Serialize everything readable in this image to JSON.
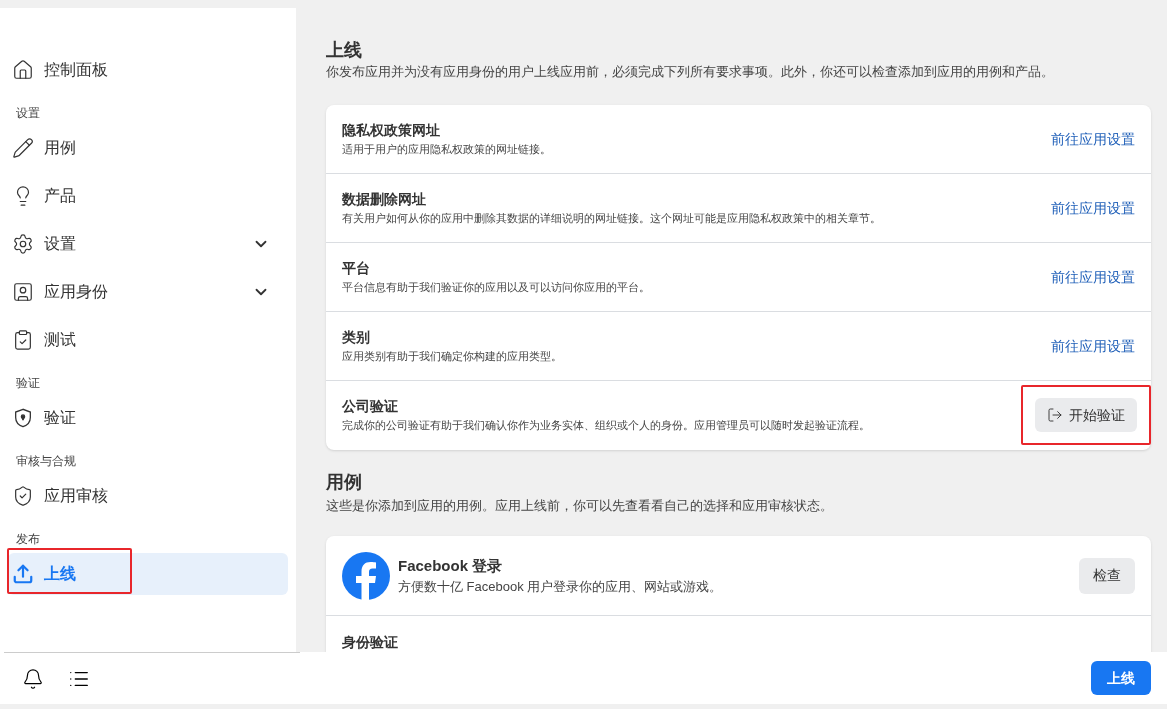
{
  "sidebar": {
    "items": [
      {
        "kind": "item",
        "label": "控制面板",
        "selected": false,
        "highlighted": false
      },
      {
        "kind": "section",
        "label": "设置"
      },
      {
        "kind": "item",
        "label": "用例",
        "selected": false,
        "highlighted": false
      },
      {
        "kind": "item",
        "label": "产品",
        "selected": false,
        "highlighted": false
      },
      {
        "kind": "item",
        "label": "设置",
        "selected": false,
        "expanded": false,
        "highlighted": false
      },
      {
        "kind": "item",
        "label": "应用身份",
        "selected": false,
        "expanded": false,
        "highlighted": false
      },
      {
        "kind": "item",
        "label": "测试",
        "selected": false,
        "highlighted": false
      },
      {
        "kind": "section",
        "label": "验证"
      },
      {
        "kind": "item",
        "label": "验证",
        "selected": false,
        "highlighted": false
      },
      {
        "kind": "section",
        "label": "审核与合规"
      },
      {
        "kind": "item",
        "label": "应用审核",
        "selected": false,
        "highlighted": false
      },
      {
        "kind": "section",
        "label": "发布"
      },
      {
        "kind": "item",
        "label": "上线",
        "selected": true,
        "highlighted": true
      }
    ]
  },
  "go_live": {
    "title": "上线",
    "description": "你发布应用并为没有应用身份的用户上线应用前，必须完成下列所有要求事项。此外，你还可以检查添加到应用的用例和产品。",
    "requirements": [
      {
        "title": "隐私权政策网址",
        "description": "适用于用户的应用隐私权政策的网址链接。",
        "action": {
          "kind": "link",
          "label": "前往应用设置",
          "highlighted": false
        }
      },
      {
        "title": "数据删除网址",
        "description": "有关用户如何从你的应用中删除其数据的详细说明的网址链接。这个网址可能是应用隐私权政策中的相关章节。",
        "action": {
          "kind": "link",
          "label": "前往应用设置",
          "highlighted": false
        }
      },
      {
        "title": "平台",
        "description": "平台信息有助于我们验证你的应用以及可以访问你应用的平台。",
        "action": {
          "kind": "link",
          "label": "前往应用设置",
          "highlighted": false
        }
      },
      {
        "title": "类别",
        "description": "应用类别有助于我们确定你构建的应用类型。",
        "action": {
          "kind": "link",
          "label": "前往应用设置",
          "highlighted": false
        }
      },
      {
        "title": "公司验证",
        "description": "完成你的公司验证有助于我们确认你作为业务实体、组织或个人的身份。应用管理员可以随时发起验证流程。",
        "action": {
          "kind": "button",
          "label": "开始验证",
          "highlighted": true
        }
      }
    ]
  },
  "use_cases": {
    "title": "用例",
    "description": "这些是你添加到应用的用例。应用上线前，你可以先查看看自己的选择和应用审核状态。",
    "items": [
      {
        "title": "Facebook 登录",
        "description": "方便数十亿 Facebook 用户登录你的应用、网站或游戏。",
        "button": "检查",
        "sub_section": "身份验证"
      }
    ]
  },
  "footer": {
    "button": "上线"
  }
}
